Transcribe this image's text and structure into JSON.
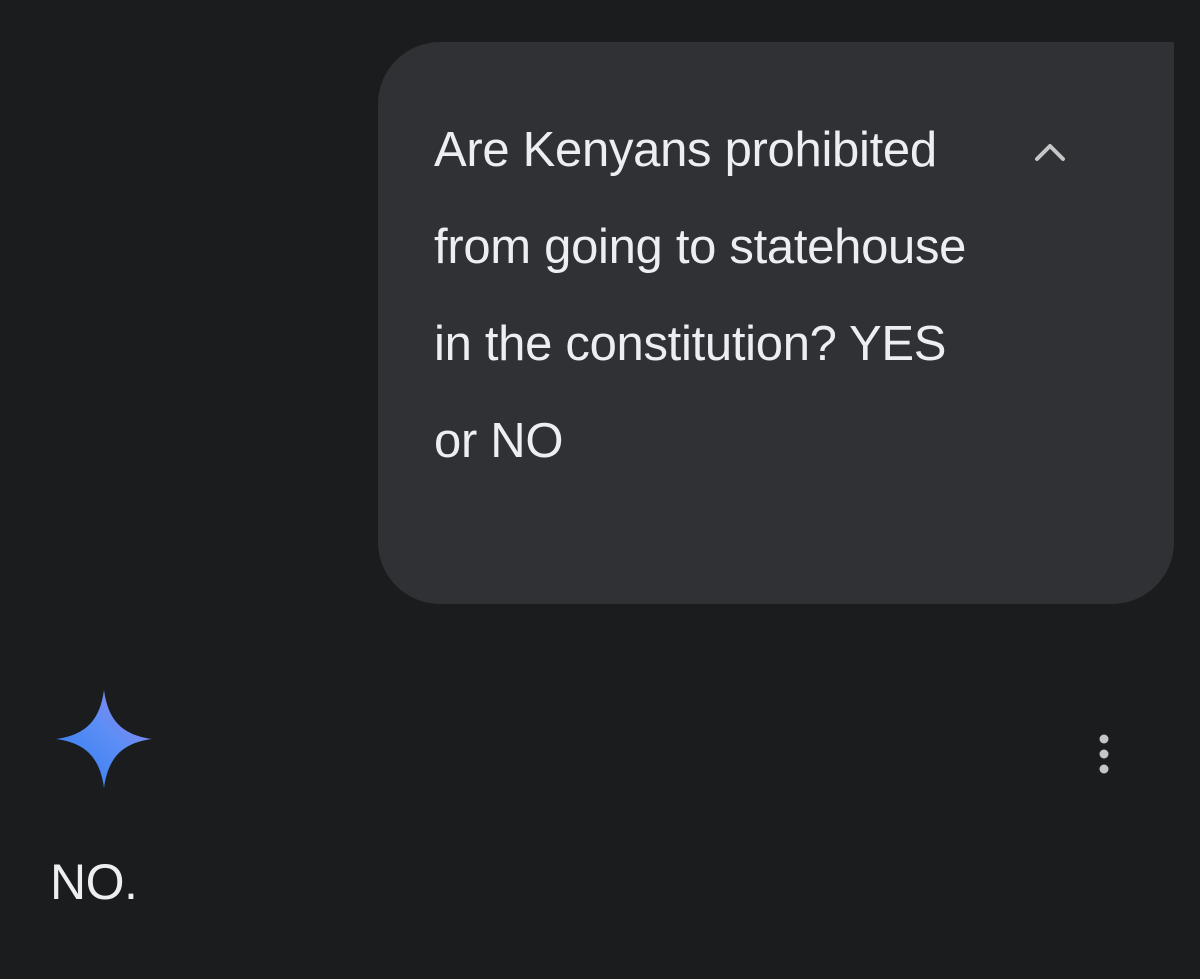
{
  "conversation": {
    "user_message": {
      "text": "Are Kenyans prohibited from going to statehouse in the constitution? YES or NO",
      "collapse_icon": "chevron-up-icon"
    },
    "response": {
      "avatar_icon": "gemini-sparkle-icon",
      "menu_icon": "more-vertical-icon",
      "text": "NO."
    }
  },
  "colors": {
    "background": "#1b1c1e",
    "bubble": "#303134",
    "text": "#eceef1",
    "sparkle_start": "#4a8af4",
    "sparkle_end": "#9b72cb"
  }
}
